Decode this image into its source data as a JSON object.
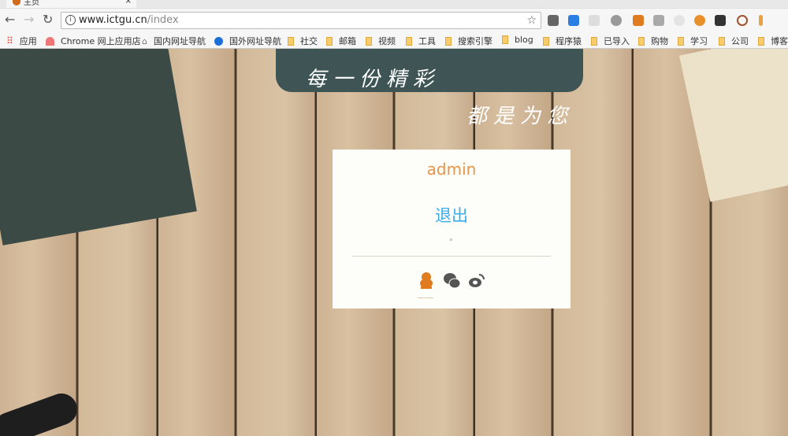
{
  "browser": {
    "tab_title": "主页",
    "url_host": "www.ictgu.cn",
    "url_path": "/index",
    "bookmarks": [
      {
        "label": "应用",
        "icon": "apps-icon"
      },
      {
        "label": "Chrome 网上应用店",
        "icon": "chrome-store-icon"
      },
      {
        "label": "国内网址导航",
        "icon": "home-icon"
      },
      {
        "label": "国外网址导航",
        "icon": "globe-icon"
      },
      {
        "label": "社交",
        "icon": "folder-icon"
      },
      {
        "label": "邮箱",
        "icon": "folder-icon"
      },
      {
        "label": "视频",
        "icon": "folder-icon"
      },
      {
        "label": "工具",
        "icon": "folder-icon"
      },
      {
        "label": "搜索引擎",
        "icon": "folder-icon"
      },
      {
        "label": "blog",
        "icon": "folder-icon"
      },
      {
        "label": "程序猿",
        "icon": "folder-icon"
      },
      {
        "label": "已导入",
        "icon": "folder-icon"
      },
      {
        "label": "购物",
        "icon": "folder-icon"
      },
      {
        "label": "学习",
        "icon": "folder-icon"
      },
      {
        "label": "公司",
        "icon": "folder-icon"
      },
      {
        "label": "博客",
        "icon": "folder-icon"
      }
    ]
  },
  "hero": {
    "line1": "每一份精彩",
    "line2": "都是为您"
  },
  "card": {
    "username": "admin",
    "logout_label": "退出"
  },
  "colors": {
    "username": "#e8954a",
    "logout": "#3aaeea",
    "qq": "#e07b20",
    "icon_gray": "#555555"
  }
}
